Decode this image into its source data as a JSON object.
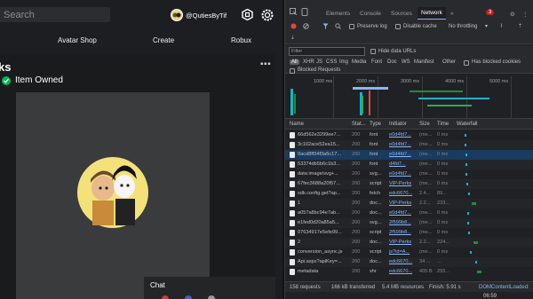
{
  "roblox": {
    "search_placeholder": "Search",
    "username": "@QutiesByTif",
    "nav": {
      "avatar_shop": "Avatar Shop",
      "create": "Create",
      "robux": "Robux"
    },
    "page_title": "ks",
    "owned_text": "Item Owned",
    "chat_label": "Chat"
  },
  "devtools": {
    "tabs": [
      "Elements",
      "Console",
      "Sources",
      "Network"
    ],
    "active_tab": "Network",
    "error_badge": "3",
    "toolbar": {
      "preserve_log": "Preserve log",
      "disable_cache": "Disable cache",
      "throttling": "No throttling"
    },
    "filter_placeholder": "Filter",
    "hide_data_urls": "Hide data URLs",
    "types": [
      "All",
      "XHR",
      "JS",
      "CSS",
      "Img",
      "Media",
      "Font",
      "Doc",
      "WS",
      "Manifest",
      "Other"
    ],
    "has_blocked_cookies": "Has blocked cookies",
    "blocked_requests": "Blocked Requests",
    "timeline_labels": [
      "1000 ms",
      "2000 ms",
      "3000 ms",
      "4000 ms",
      "5000 ms"
    ],
    "columns": [
      "Name",
      "Stat...",
      "Type",
      "Initiator",
      "Size",
      "Time",
      "Waterfall"
    ],
    "rows": [
      {
        "name": "66d562e3299ee7...",
        "status": "200",
        "type": "font",
        "initiator": "e0d4fd7...",
        "size": "(me...",
        "time": "0 ms"
      },
      {
        "name": "3c102ace52ea15...",
        "status": "200",
        "type": "font",
        "initiator": "e0d4fd7...",
        "size": "(me...",
        "time": "0 ms"
      },
      {
        "name": "0acd8ff34f3a5c17...",
        "status": "200",
        "type": "font",
        "initiator": "e0d4fd7...",
        "size": "(me...",
        "time": "0 ms"
      },
      {
        "name": "53374db5b6c1b3...",
        "status": "200",
        "type": "font",
        "initiator": "d4fd7...",
        "size": "(me...",
        "time": "0 ms"
      },
      {
        "name": "data:image/svg+...",
        "status": "200",
        "type": "svg...",
        "initiator": "e0d4fd7...",
        "size": "(me...",
        "time": "0 ms"
      },
      {
        "name": "67fec3688a20f57...",
        "status": "200",
        "type": "script",
        "initiator": "VIP-Perks",
        "size": "(me...",
        "time": "0 ms"
      },
      {
        "name": "sdk.config.get?ap...",
        "status": "200",
        "type": "fetch",
        "initiator": "edc6670...",
        "size": "2.4...",
        "time": "89..."
      },
      {
        "name": "1",
        "status": "200",
        "type": "doc...",
        "initiator": "VIP-Perks",
        "size": "2.2...",
        "time": "233..."
      },
      {
        "name": "a057a8bc94e7ab...",
        "status": "200",
        "type": "doc...",
        "initiator": "e0d4fd7...",
        "size": "(me...",
        "time": "0 ms"
      },
      {
        "name": "e1fed0d20a85a5...",
        "status": "200",
        "type": "svg...",
        "initiator": "2f599b8...",
        "size": "(me...",
        "time": "0 ms"
      },
      {
        "name": "07634917e5efe99...",
        "status": "200",
        "type": "script",
        "initiator": "2f599b8...",
        "size": "(me...",
        "time": "0 ms"
      },
      {
        "name": "2",
        "status": "200",
        "type": "doc...",
        "initiator": "VIP-Perks",
        "size": "2.2...",
        "time": "224..."
      },
      {
        "name": "conversion_async.js",
        "status": "200",
        "type": "script",
        "initiator": "js?id=A...",
        "size": "(me...",
        "time": "0 ms"
      },
      {
        "name": "Api.aspx?apiKey=...",
        "status": "200",
        "type": "doc...",
        "initiator": "edc6670...",
        "size": "34 ...",
        "time": "..."
      },
      {
        "name": "metadata",
        "status": "200",
        "type": "xhr",
        "initiator": "edc6670...",
        "size": "405 B",
        "time": "255..."
      }
    ],
    "status_bar": {
      "requests": "158 requests",
      "transferred": "166 kB transferred",
      "resources": "5.4 MB resources",
      "finish": "Finish: 5.91 s",
      "dom": "DOMContentLoaded:"
    },
    "clock": "06:59"
  },
  "colors": {
    "accent": "#8ab4f8",
    "owned_green": "#02b757",
    "error_red": "#c4231e"
  }
}
